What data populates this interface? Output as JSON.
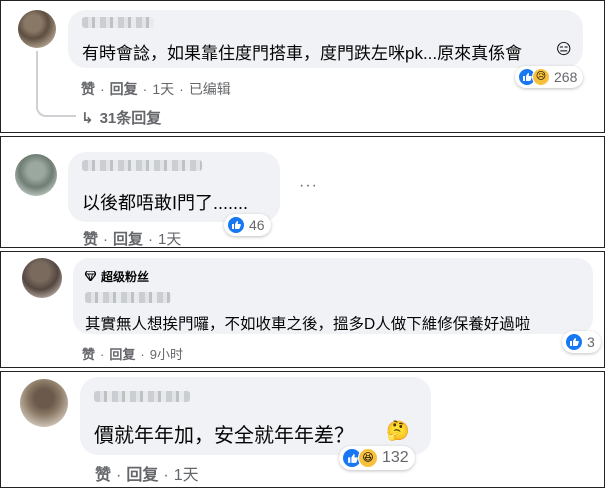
{
  "colors": {
    "like_blue": "#1877f2",
    "meta_gray": "#65676b",
    "bubble_bg": "#f0f2f5",
    "emoji_yellow": "#f7c13d"
  },
  "comments": [
    {
      "text": "有時會諗，如果靠住度門搭車，度門跌左咪pk...原來真係會",
      "actions": {
        "like": "赞",
        "reply": "回复",
        "time": "1天",
        "edited": "已编辑"
      },
      "reactions": {
        "icons": [
          "like-icon",
          "sad-icon"
        ],
        "count": "268"
      },
      "replies_link": "31条回复"
    },
    {
      "text": "以後都唔敢I門了.......",
      "actions": {
        "like": "赞",
        "reply": "回复",
        "time": "1天"
      },
      "reactions": {
        "icons": [
          "like-icon"
        ],
        "count": "46"
      }
    },
    {
      "badge": "超级粉丝",
      "text": "其實無人想挨門囉，不如收車之後，搵多D人做下維修保養好過啦",
      "actions": {
        "like": "赞",
        "reply": "回复",
        "time": "9小时"
      },
      "reactions": {
        "icons": [
          "like-icon"
        ],
        "count": "3"
      }
    },
    {
      "text": "價就年年加，安全就年年差？",
      "actions": {
        "like": "赞",
        "reply": "回复",
        "time": "1天"
      },
      "reactions": {
        "icons": [
          "like-icon",
          "haha-icon"
        ],
        "count": "132"
      }
    }
  ]
}
